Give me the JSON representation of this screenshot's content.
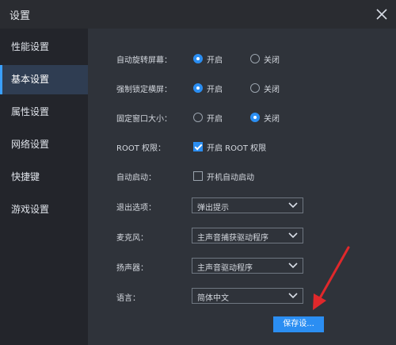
{
  "window": {
    "title": "设置"
  },
  "sidebar": {
    "items": [
      {
        "label": "性能设置"
      },
      {
        "label": "基本设置",
        "active": true
      },
      {
        "label": "属性设置"
      },
      {
        "label": "网络设置"
      },
      {
        "label": "快捷键"
      },
      {
        "label": "游戏设置"
      }
    ]
  },
  "settings": {
    "auto_rotate": {
      "label": "自动旋转屏幕：",
      "on_label": "开启",
      "off_label": "关闭",
      "selected": "on"
    },
    "force_landscape": {
      "label": "强制锁定横屏：",
      "on_label": "开启",
      "off_label": "关闭",
      "selected": "on"
    },
    "fixed_window": {
      "label": "固定窗口大小：",
      "on_label": "开启",
      "off_label": "关闭",
      "selected": "off"
    },
    "root": {
      "label": "ROOT 权限：",
      "option_label": "开启 ROOT 权限",
      "checked": true
    },
    "autostart": {
      "label": "自动启动：",
      "option_label": "开机自动启动",
      "checked": false
    },
    "exit_option": {
      "label": "退出选项：",
      "value": "弹出提示"
    },
    "microphone": {
      "label": "麦克风：",
      "value": "主声音捕获驱动程序"
    },
    "speaker": {
      "label": "扬声器：",
      "value": "主声音驱动程序"
    },
    "language": {
      "label": "语言：",
      "value": "简体中文"
    }
  },
  "buttons": {
    "save_label": "保存设..."
  },
  "colors": {
    "accent": "#2b8ef2",
    "annotation_arrow": "#e0282b"
  },
  "icons": {
    "close": "close-icon",
    "dropdown": "chevron-down-icon",
    "annotation": "red-arrow-annotation"
  }
}
